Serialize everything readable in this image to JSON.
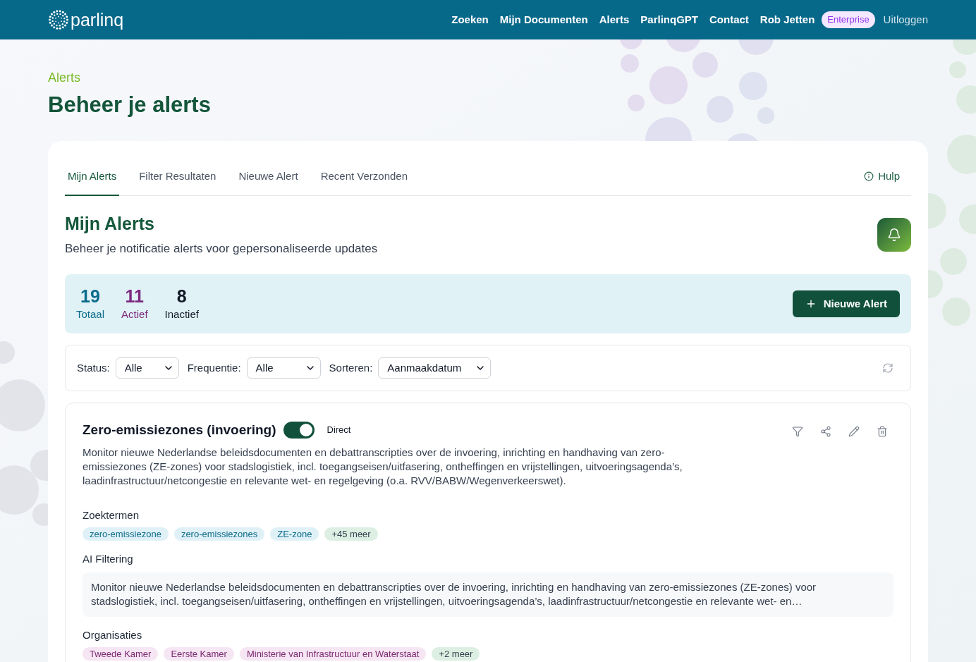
{
  "header": {
    "logo": "parlinq",
    "nav": [
      {
        "label": "Zoeken",
        "kind": "link"
      },
      {
        "label": "Mijn Documenten",
        "kind": "link"
      },
      {
        "label": "Alerts",
        "kind": "link"
      },
      {
        "label": "ParlinqGPT",
        "kind": "link"
      },
      {
        "label": "Contact",
        "kind": "link"
      },
      {
        "label": "Rob Jetten",
        "kind": "link"
      },
      {
        "label": "Enterprise",
        "kind": "badge"
      },
      {
        "label": "Uitloggen",
        "kind": "logout"
      }
    ]
  },
  "page": {
    "eyebrow": "Alerts",
    "title": "Beheer je alerts"
  },
  "tabs": [
    {
      "label": "Mijn Alerts",
      "selected": true
    },
    {
      "label": "Filter Resultaten",
      "selected": false
    },
    {
      "label": "Nieuwe Alert",
      "selected": false
    },
    {
      "label": "Recent Verzonden",
      "selected": false
    }
  ],
  "help": "Hulp",
  "section": {
    "title": "Mijn Alerts",
    "subtitle": "Beheer je notificatie alerts voor gepersonaliseerde updates"
  },
  "stats_panel": {
    "stats": [
      {
        "value": "19",
        "label": "Totaal",
        "color": "#0b6c8c"
      },
      {
        "value": "11",
        "label": "Actief",
        "color": "#7c2a7f"
      },
      {
        "value": "8",
        "label": "Inactief",
        "color": "#111827"
      }
    ],
    "button": "Nieuwe Alert"
  },
  "filters": [
    {
      "label": "Status:",
      "value": "Alle"
    },
    {
      "label": "Frequentie:",
      "value": "Alle"
    },
    {
      "label": "Sorteren:",
      "value": "Aanmaakdatum"
    }
  ],
  "alerts": [
    {
      "title": "Zero-emissiezones (invoering)",
      "on": true,
      "frequency": "Direct",
      "description": "Monitor nieuwe Nederlandse beleidsdocumenten en debattranscripties over de invoering, inrichting en handhaving van zero-emissiezones (ZE-zones) voor stadslogistiek, incl. toegangseisen/uitfasering, ontheffingen en vrijstellingen, uitvoeringsagenda’s, laadinfrastructuur/netcongestie en relevante wet- en regelgeving (o.a. RVV/BABW/Wegenverkeerswet).",
      "sections": [
        {
          "heading": "Zoektermen",
          "kind": "tags",
          "tags": [
            {
              "label": "zero-emissiezone",
              "kind": "term"
            },
            {
              "label": "zero-emissiezones",
              "kind": "term"
            },
            {
              "label": "ZE-zone",
              "kind": "term"
            },
            {
              "label": "+45 meer",
              "kind": "more"
            }
          ]
        },
        {
          "heading": "AI Filtering",
          "kind": "text",
          "text": "Monitor nieuwe Nederlandse beleidsdocumenten en debattranscripties over de invoering, inrichting en handhaving van zero-emissiezones (ZE-zones) voor stadslogistiek, incl. toegangseisen/uitfasering, ontheffingen en vrijstellingen, uitvoeringsagenda’s, laadinfrastructuur/netcongestie en relevante wet- en…"
        },
        {
          "heading": "Organisaties",
          "kind": "tags",
          "tags": [
            {
              "label": "Tweede Kamer",
              "kind": "org"
            },
            {
              "label": "Eerste Kamer",
              "kind": "org"
            },
            {
              "label": "Ministerie van Infrastructuur en Waterstaat",
              "kind": "org"
            },
            {
              "label": "+2 meer",
              "kind": "more"
            }
          ]
        }
      ]
    }
  ]
}
